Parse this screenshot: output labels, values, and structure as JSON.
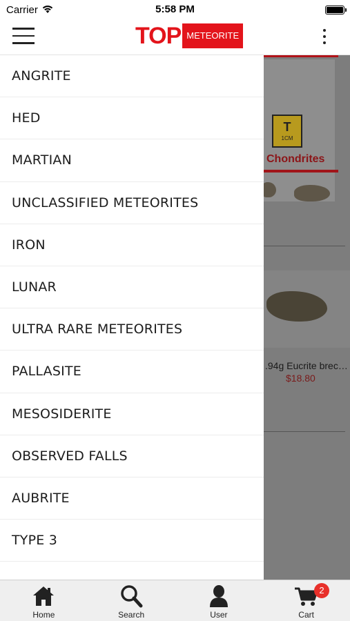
{
  "status_bar": {
    "carrier": "Carrier",
    "time": "5:58 PM"
  },
  "header": {
    "logo_main": "TOP",
    "logo_badge": "METEORITE",
    "brand_color": "#e3141b"
  },
  "background_page": {
    "category_title": "Chondrites",
    "cube_letter": "T",
    "cube_unit": "1CM",
    "product_name": ".94g Eucrite brec…",
    "product_price": "$18.80"
  },
  "drawer": {
    "items": [
      {
        "label": "ANGRITE"
      },
      {
        "label": "HED"
      },
      {
        "label": "MARTIAN"
      },
      {
        "label": "UNCLASSIFIED METEORITES"
      },
      {
        "label": "IRON"
      },
      {
        "label": "LUNAR"
      },
      {
        "label": "ULTRA RARE METEORITES"
      },
      {
        "label": "PALLASITE"
      },
      {
        "label": "MESOSIDERITE"
      },
      {
        "label": "OBSERVED FALLS"
      },
      {
        "label": "AUBRITE"
      },
      {
        "label": "TYPE 3"
      }
    ]
  },
  "tab_bar": {
    "tabs": [
      {
        "label": "Home",
        "icon": "home-icon"
      },
      {
        "label": "Search",
        "icon": "search-icon"
      },
      {
        "label": "User",
        "icon": "user-icon"
      },
      {
        "label": "Cart",
        "icon": "cart-icon",
        "badge": "2"
      }
    ],
    "badge_color": "#e8302a"
  }
}
